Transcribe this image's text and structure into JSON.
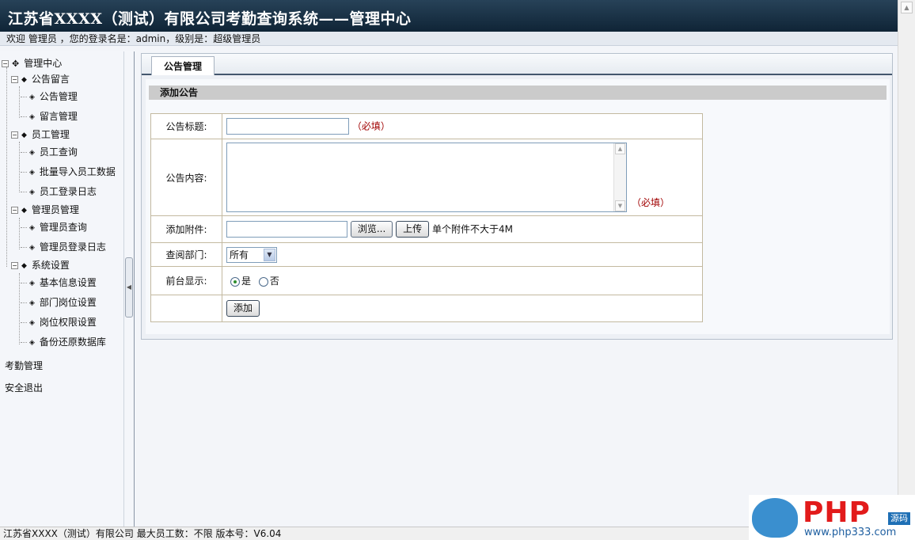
{
  "header": {
    "title": "江苏省XXXX（测试）有限公司考勤查询系统——管理中心",
    "welcome": "欢迎 管理员 ，您的登录名是：admin，级别是：超级管理员"
  },
  "sidebar": {
    "root": "管理中心",
    "groups": [
      {
        "label": "公告留言",
        "items": [
          "公告管理",
          "留言管理"
        ]
      },
      {
        "label": "员工管理",
        "items": [
          "员工查询",
          "批量导入员工数据",
          "员工登录日志"
        ]
      },
      {
        "label": "管理员管理",
        "items": [
          "管理员查询",
          "管理员登录日志"
        ]
      },
      {
        "label": "系统设置",
        "items": [
          "基本信息设置",
          "部门岗位设置",
          "岗位权限设置",
          "备份还原数据库"
        ]
      }
    ],
    "extra": [
      "考勤管理",
      "安全退出"
    ]
  },
  "main": {
    "tab": "公告管理",
    "section_title": "添加公告",
    "form": {
      "title_label": "公告标题:",
      "title_value": "",
      "required": "（必填）",
      "content_label": "公告内容:",
      "content_value": "",
      "attach_label": "添加附件:",
      "browse_button": "浏览...",
      "upload_button": "上传",
      "attach_note": "单个附件不大于4M",
      "dept_label": "查阅部门:",
      "dept_selected": "所有",
      "display_label": "前台显示:",
      "display_yes": "是",
      "display_no": "否",
      "display_selected": "是",
      "submit_button": "添加"
    }
  },
  "footer": {
    "text": "江苏省XXXX（测试）有限公司  最大员工数：不限  版本号：V6.04"
  },
  "watermark": {
    "brand": "PHP",
    "tag": "源码",
    "url": "www.php333.com"
  }
}
